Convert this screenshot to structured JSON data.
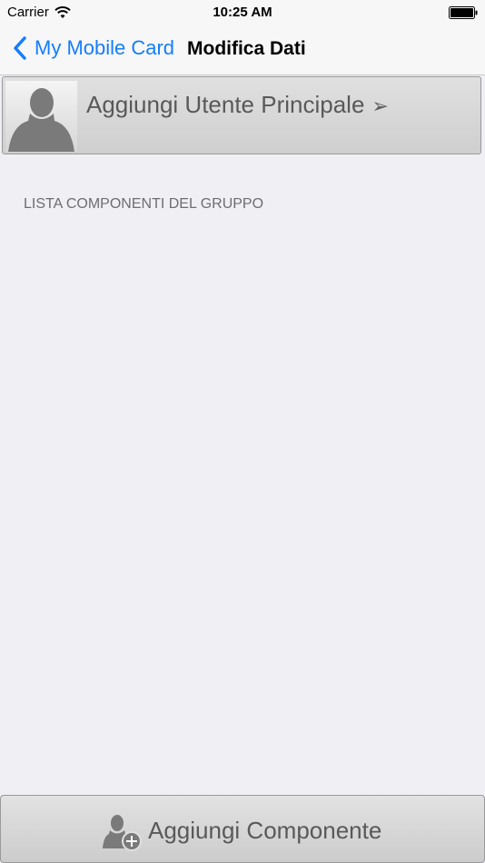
{
  "status_bar": {
    "carrier": "Carrier",
    "time": "10:25 AM",
    "wifi_icon": "wifi-icon",
    "battery_icon": "battery-icon"
  },
  "nav": {
    "back_label": "My Mobile Card",
    "back_icon": "chevron-left-icon",
    "title": "Modifica Dati",
    "accent_color": "#157efb"
  },
  "primary_user": {
    "label": "Aggiungi Utente Principale",
    "arrow": "➢",
    "avatar_icon": "person-silhouette-icon"
  },
  "section": {
    "header": "LISTA COMPONENTI DEL GRUPPO",
    "items": []
  },
  "footer": {
    "add_label": "Aggiungi Componente",
    "add_icon": "add-user-icon"
  }
}
